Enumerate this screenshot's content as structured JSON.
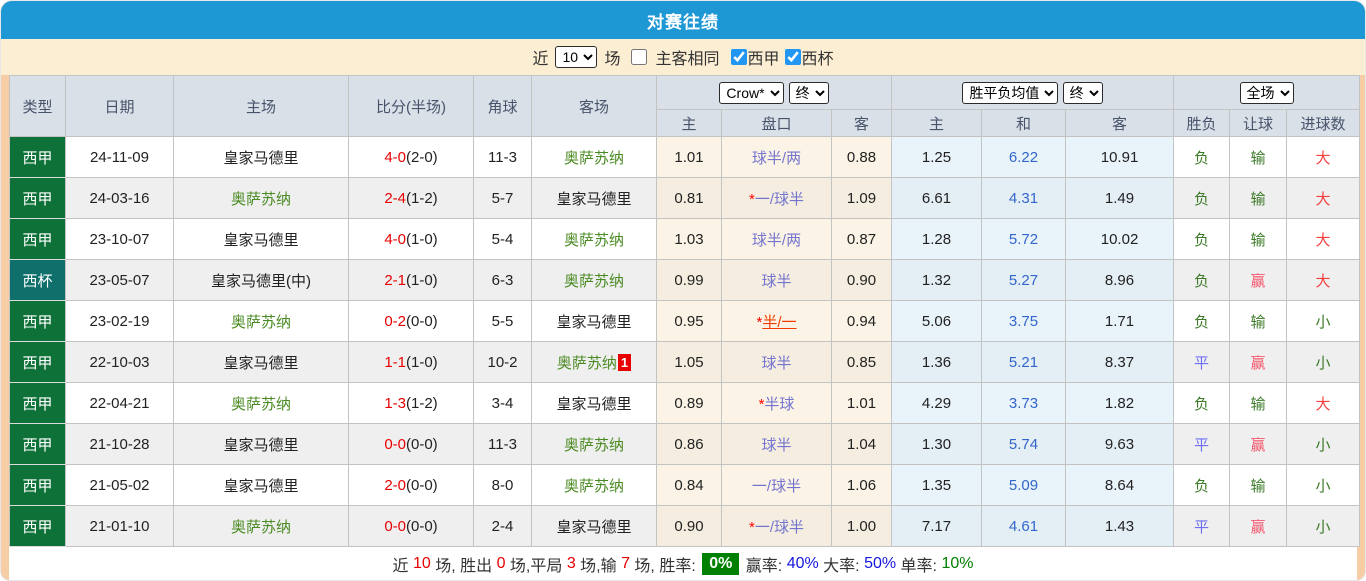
{
  "title": "对赛往绩",
  "colors": {
    "accent_blue": "#1e97d5",
    "filter_bg": "#fbeed3",
    "frame_peach": "#f7cda6",
    "header_bg": "#dae0e8",
    "league_green": "#0e7138",
    "cup_teal": "#0e6f6b",
    "score_red": "#e80000",
    "team_green": "#4a8a22",
    "handicap_blue": "#7474cf",
    "handicap_red": "#f03c00",
    "avg_mid_blue": "#3366cc",
    "result_green": "#3c7a28",
    "result_violet": "#6e6ef5",
    "result_pink": "#f5576c",
    "result_red": "#f54040",
    "summary_badge_green": "#008000",
    "summary_blue": "#1515e0",
    "checkbox_blue": "#2196f3"
  },
  "filter": {
    "recent_label": "近",
    "count_select": "10",
    "matches_label": "场",
    "same_venue_label": "主客相同",
    "same_venue_checked": false,
    "leagues": [
      {
        "label": "西甲",
        "checked": true
      },
      {
        "label": "西杯",
        "checked": true
      }
    ]
  },
  "table": {
    "headers": {
      "type": "类型",
      "date": "日期",
      "home": "主场",
      "score": "比分(半场)",
      "corner": "角球",
      "away": "客场",
      "bookmaker_select": "Crow*",
      "odds_time_select": "终",
      "avg_select": "胜平负均值",
      "avg_time_select": "终",
      "scope_select": "全场",
      "sub": [
        "主",
        "盘口",
        "客",
        "主",
        "和",
        "客",
        "胜负",
        "让球",
        "进球数"
      ]
    },
    "rows": [
      {
        "type": "西甲",
        "type_class": "liga",
        "date": "24-11-09",
        "home": "皇家马德里",
        "home_green": false,
        "score": "4-0",
        "half": "(2-0)",
        "corner": "11-3",
        "away": "奥萨苏纳",
        "away_green": true,
        "away_badge": "",
        "odds_home": "1.01",
        "hcp_star": false,
        "hcp": "球半/两",
        "hcp_red": false,
        "odds_away": "0.88",
        "avg_home": "1.25",
        "avg_draw": "6.22",
        "avg_away": "10.91",
        "res_wdl": "负",
        "res_wdl_c": "res-green",
        "res_hcp": "输",
        "res_hcp_c": "res-green",
        "res_goal": "大",
        "res_goal_c": "res-red"
      },
      {
        "type": "西甲",
        "type_class": "liga",
        "date": "24-03-16",
        "home": "奥萨苏纳",
        "home_green": true,
        "score": "2-4",
        "half": "(1-2)",
        "corner": "5-7",
        "away": "皇家马德里",
        "away_green": false,
        "away_badge": "",
        "odds_home": "0.81",
        "hcp_star": true,
        "hcp": "一/球半",
        "hcp_red": false,
        "odds_away": "1.09",
        "avg_home": "6.61",
        "avg_draw": "4.31",
        "avg_away": "1.49",
        "res_wdl": "负",
        "res_wdl_c": "res-green",
        "res_hcp": "输",
        "res_hcp_c": "res-green",
        "res_goal": "大",
        "res_goal_c": "res-red"
      },
      {
        "type": "西甲",
        "type_class": "liga",
        "date": "23-10-07",
        "home": "皇家马德里",
        "home_green": false,
        "score": "4-0",
        "half": "(1-0)",
        "corner": "5-4",
        "away": "奥萨苏纳",
        "away_green": true,
        "away_badge": "",
        "odds_home": "1.03",
        "hcp_star": false,
        "hcp": "球半/两",
        "hcp_red": false,
        "odds_away": "0.87",
        "avg_home": "1.28",
        "avg_draw": "5.72",
        "avg_away": "10.02",
        "res_wdl": "负",
        "res_wdl_c": "res-green",
        "res_hcp": "输",
        "res_hcp_c": "res-green",
        "res_goal": "大",
        "res_goal_c": "res-red"
      },
      {
        "type": "西杯",
        "type_class": "cup",
        "date": "23-05-07",
        "home": "皇家马德里(中)",
        "home_green": false,
        "score": "2-1",
        "half": "(1-0)",
        "corner": "6-3",
        "away": "奥萨苏纳",
        "away_green": true,
        "away_badge": "",
        "odds_home": "0.99",
        "hcp_star": false,
        "hcp": "球半",
        "hcp_red": false,
        "odds_away": "0.90",
        "avg_home": "1.32",
        "avg_draw": "5.27",
        "avg_away": "8.96",
        "res_wdl": "负",
        "res_wdl_c": "res-green",
        "res_hcp": "赢",
        "res_hcp_c": "res-pink",
        "res_goal": "大",
        "res_goal_c": "res-red"
      },
      {
        "type": "西甲",
        "type_class": "liga",
        "date": "23-02-19",
        "home": "奥萨苏纳",
        "home_green": true,
        "score": "0-2",
        "half": "(0-0)",
        "corner": "5-5",
        "away": "皇家马德里",
        "away_green": false,
        "away_badge": "",
        "odds_home": "0.95",
        "hcp_star": true,
        "hcp": "半/一",
        "hcp_red": true,
        "odds_away": "0.94",
        "avg_home": "5.06",
        "avg_draw": "3.75",
        "avg_away": "1.71",
        "res_wdl": "负",
        "res_wdl_c": "res-green",
        "res_hcp": "输",
        "res_hcp_c": "res-green",
        "res_goal": "小",
        "res_goal_c": "res-green"
      },
      {
        "type": "西甲",
        "type_class": "liga",
        "date": "22-10-03",
        "home": "皇家马德里",
        "home_green": false,
        "score": "1-1",
        "half": "(1-0)",
        "corner": "10-2",
        "away": "奥萨苏纳",
        "away_green": true,
        "away_badge": "1",
        "odds_home": "1.05",
        "hcp_star": false,
        "hcp": "球半",
        "hcp_red": false,
        "odds_away": "0.85",
        "avg_home": "1.36",
        "avg_draw": "5.21",
        "avg_away": "8.37",
        "res_wdl": "平",
        "res_wdl_c": "res-violet",
        "res_hcp": "赢",
        "res_hcp_c": "res-pink",
        "res_goal": "小",
        "res_goal_c": "res-green"
      },
      {
        "type": "西甲",
        "type_class": "liga",
        "date": "22-04-21",
        "home": "奥萨苏纳",
        "home_green": true,
        "score": "1-3",
        "half": "(1-2)",
        "corner": "3-4",
        "away": "皇家马德里",
        "away_green": false,
        "away_badge": "",
        "odds_home": "0.89",
        "hcp_star": true,
        "hcp": "半球",
        "hcp_red": false,
        "odds_away": "1.01",
        "avg_home": "4.29",
        "avg_draw": "3.73",
        "avg_away": "1.82",
        "res_wdl": "负",
        "res_wdl_c": "res-green",
        "res_hcp": "输",
        "res_hcp_c": "res-green",
        "res_goal": "大",
        "res_goal_c": "res-red"
      },
      {
        "type": "西甲",
        "type_class": "liga",
        "date": "21-10-28",
        "home": "皇家马德里",
        "home_green": false,
        "score": "0-0",
        "half": "(0-0)",
        "corner": "11-3",
        "away": "奥萨苏纳",
        "away_green": true,
        "away_badge": "",
        "odds_home": "0.86",
        "hcp_star": false,
        "hcp": "球半",
        "hcp_red": false,
        "odds_away": "1.04",
        "avg_home": "1.30",
        "avg_draw": "5.74",
        "avg_away": "9.63",
        "res_wdl": "平",
        "res_wdl_c": "res-violet",
        "res_hcp": "赢",
        "res_hcp_c": "res-pink",
        "res_goal": "小",
        "res_goal_c": "res-green"
      },
      {
        "type": "西甲",
        "type_class": "liga",
        "date": "21-05-02",
        "home": "皇家马德里",
        "home_green": false,
        "score": "2-0",
        "half": "(0-0)",
        "corner": "8-0",
        "away": "奥萨苏纳",
        "away_green": true,
        "away_badge": "",
        "odds_home": "0.84",
        "hcp_star": false,
        "hcp": "一/球半",
        "hcp_red": false,
        "odds_away": "1.06",
        "avg_home": "1.35",
        "avg_draw": "5.09",
        "avg_away": "8.64",
        "res_wdl": "负",
        "res_wdl_c": "res-green",
        "res_hcp": "输",
        "res_hcp_c": "res-green",
        "res_goal": "小",
        "res_goal_c": "res-green"
      },
      {
        "type": "西甲",
        "type_class": "liga",
        "date": "21-01-10",
        "home": "奥萨苏纳",
        "home_green": true,
        "score": "0-0",
        "half": "(0-0)",
        "corner": "2-4",
        "away": "皇家马德里",
        "away_green": false,
        "away_badge": "",
        "odds_home": "0.90",
        "hcp_star": true,
        "hcp": "一/球半",
        "hcp_red": false,
        "odds_away": "1.00",
        "avg_home": "7.17",
        "avg_draw": "4.61",
        "avg_away": "1.43",
        "res_wdl": "平",
        "res_wdl_c": "res-violet",
        "res_hcp": "赢",
        "res_hcp_c": "res-pink",
        "res_goal": "小",
        "res_goal_c": "res-green"
      }
    ]
  },
  "summary": {
    "segments": [
      {
        "t": "近 ",
        "c": "plain"
      },
      {
        "t": "10",
        "c": "red"
      },
      {
        "t": " 场, 胜出 ",
        "c": "plain"
      },
      {
        "t": "0",
        "c": "red"
      },
      {
        "t": " 场,平局 ",
        "c": "plain"
      },
      {
        "t": "3",
        "c": "red"
      },
      {
        "t": " 场,输 ",
        "c": "plain"
      },
      {
        "t": "7",
        "c": "red"
      },
      {
        "t": " 场, 胜率: ",
        "c": "plain"
      },
      {
        "t": "0%",
        "c": "badge-green"
      },
      {
        "t": " 赢率: ",
        "c": "plain"
      },
      {
        "t": "40%",
        "c": "blue"
      },
      {
        "t": " 大率: ",
        "c": "plain"
      },
      {
        "t": "50%",
        "c": "blue"
      },
      {
        "t": " 单率: ",
        "c": "plain"
      },
      {
        "t": "10%",
        "c": "green"
      }
    ]
  }
}
